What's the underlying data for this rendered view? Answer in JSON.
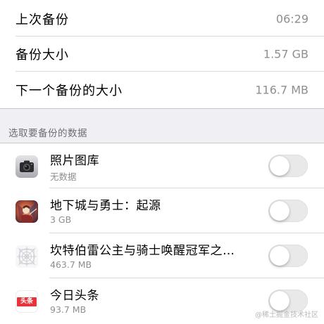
{
  "backup_info": [
    {
      "label": "上次备份",
      "value": "06:29"
    },
    {
      "label": "备份大小",
      "value": "1.57 GB"
    },
    {
      "label": "下一个备份的大小",
      "value": "116.7 MB"
    }
  ],
  "section_header": "选取要备份的数据",
  "apps": [
    {
      "name": "照片图库",
      "size": "无数据",
      "icon": "camera-icon",
      "enabled": false
    },
    {
      "name": "地下城与勇士：起源",
      "size": "3 GB",
      "icon": "game-dnf-icon",
      "enabled": false
    },
    {
      "name": "坎特伯雷公主与骑士唤醒冠军之…",
      "size": "463.7 MB",
      "icon": "app-placeholder-icon",
      "enabled": false
    },
    {
      "name": "今日头条",
      "size": "93.7 MB",
      "icon": "toutiao-icon",
      "icon_text": "头条",
      "enabled": false
    }
  ],
  "watermark": "@稀土掘金技术社区",
  "colors": {
    "background": "#efeff4",
    "secondary_text": "#8e8e93",
    "toggle_off": "#e9e9ea",
    "toutiao_red": "#e8323c"
  }
}
